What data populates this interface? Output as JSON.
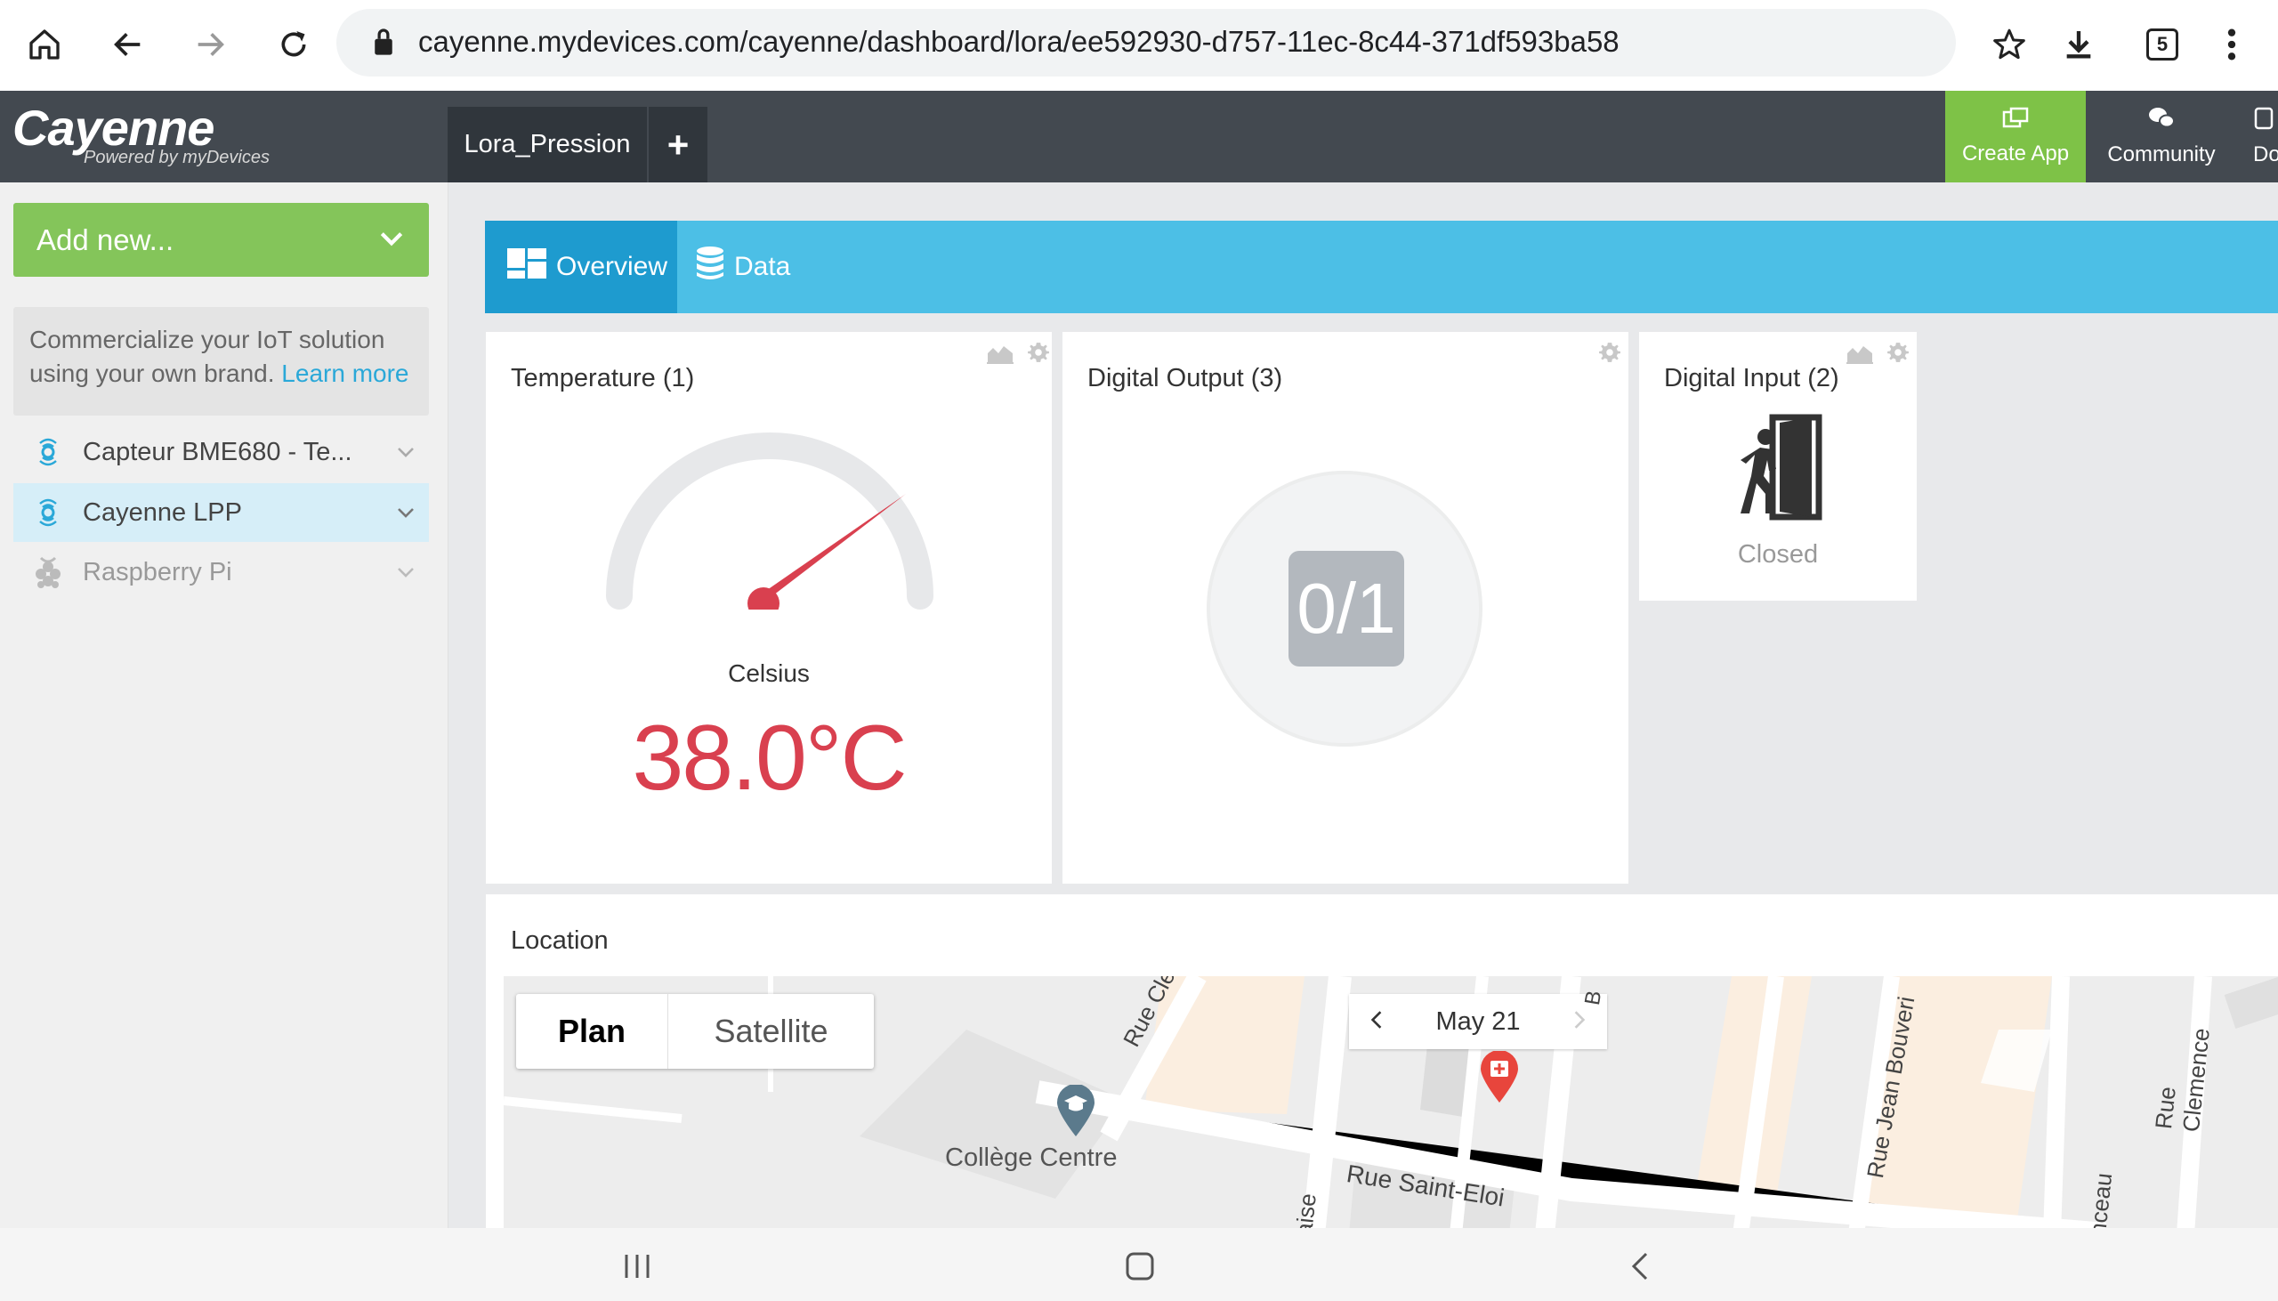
{
  "browser": {
    "url": "cayenne.mydevices.com/cayenne/dashboard/lora/ee592930-d757-11ec-8c44-371df593ba58",
    "tab_count": "5"
  },
  "header": {
    "logo": "Cayenne",
    "logo_sub": "Powered by myDevices",
    "tab_label": "Lora_Pression",
    "add_tab": "+",
    "create_app": "Create App",
    "community": "Community",
    "docs": "Do"
  },
  "sidebar": {
    "add_new": "Add new...",
    "promo_text": "Commercialize your IoT solution using your own brand.",
    "promo_link": "Learn more",
    "devices": [
      {
        "label": "Capteur BME680 - Te...",
        "icon": "lora-icon"
      },
      {
        "label": "Cayenne LPP",
        "icon": "lora-icon"
      },
      {
        "label": "Raspberry Pi",
        "icon": "raspberry-pi-icon"
      }
    ]
  },
  "main": {
    "tabs": [
      {
        "label": "Overview"
      },
      {
        "label": "Data"
      }
    ],
    "widgets": {
      "temperature": {
        "title": "Temperature (1)",
        "unit_label": "Celsius",
        "value": "38.0°C"
      },
      "digital_output": {
        "title": "Digital Output (3)",
        "value": "0/1"
      },
      "digital_input": {
        "title": "Digital Input (2)",
        "state": "Closed"
      }
    },
    "location": {
      "title": "Location",
      "map_type_plan": "Plan",
      "map_type_satellite": "Satellite",
      "date": "May 21",
      "labels": {
        "college": "Collège Centre",
        "rue_saint_eloi": "Rue Saint-Eloi",
        "rue_jean_bouveri": "Rue Jean Bouveri",
        "rue_clemence": "Rue Clemence",
        "rue_clem": "Rue Clem",
        "aise": "aise",
        "nceau": "nceau",
        "b": "B"
      }
    }
  },
  "colors": {
    "header_bg": "#434950",
    "accent_green": "#84c55a",
    "accent_blue": "#4cbfe6",
    "active_blue": "#1e9bcf",
    "temp_red": "#d9404f"
  }
}
